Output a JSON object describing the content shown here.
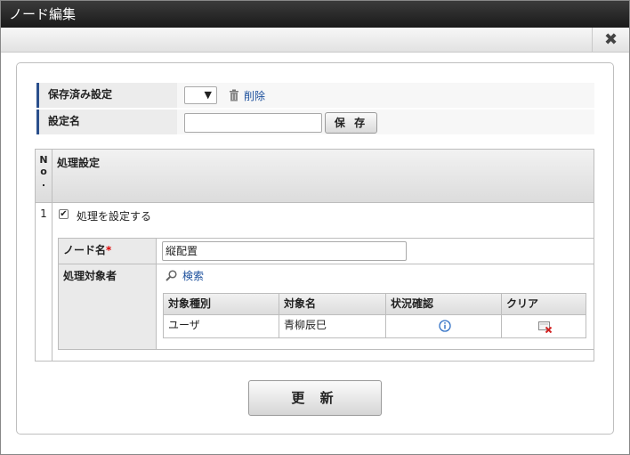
{
  "dialog": {
    "title": "ノード編集",
    "close_icon": "close-icon",
    "close_glyph": "✖"
  },
  "saved_settings": {
    "label": "保存済み設定",
    "select_arrow": "▼",
    "delete_label": "削除",
    "delete_icon": "trash-icon"
  },
  "setting_name": {
    "label": "設定名",
    "value": "",
    "save_label": "保 存"
  },
  "table": {
    "no_header": [
      "N",
      "o",
      "."
    ],
    "setting_header": "処理設定",
    "row_number": "1",
    "checkbox_checked": true,
    "checkbox_glyph": "✔",
    "checkbox_label": "処理を設定する"
  },
  "node": {
    "label": "ノード名",
    "required_mark": "*",
    "value": "縦配置"
  },
  "target": {
    "label": "処理対象者",
    "search_label": "検索",
    "search_icon": "search-icon",
    "columns": [
      "対象種別",
      "対象名",
      "状況確認",
      "クリア"
    ],
    "rows": [
      {
        "type": "ユーザ",
        "name": "青柳辰巳",
        "status_icon": "info-icon",
        "clear_icon": "clear-icon"
      }
    ]
  },
  "footer": {
    "update_label": "更 新"
  },
  "colors": {
    "title_bg": "#2a2a2a",
    "link": "#1b4f9c",
    "label_accent": "#2a4f8c",
    "required": "#dd0000",
    "info": "#2f6fc4",
    "clear_x": "#d22222"
  }
}
